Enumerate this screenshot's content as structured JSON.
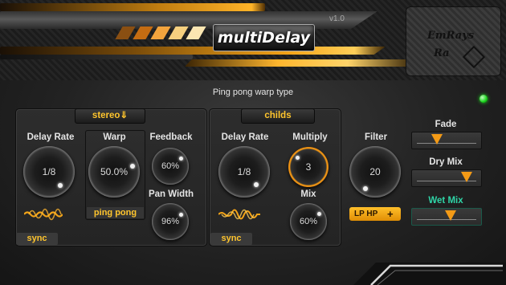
{
  "header": {
    "title": "multiDelay",
    "version": "v1.0",
    "brand_line1": "EmRays",
    "brand_line2": "Ra"
  },
  "subtitle": "Ping pong warp type",
  "colors": {
    "accent": "#ffc52d",
    "knob_ring_active": "#f39a16",
    "led_on": "#18d21a",
    "wet_mix_label": "#2fd6a8"
  },
  "left_panel": {
    "mode": "stereo⇓",
    "delay_rate": {
      "label": "Delay Rate",
      "value": "1/8"
    },
    "warp": {
      "label": "Warp",
      "value": "50.0%",
      "type": "ping pong"
    },
    "feedback": {
      "label": "Feedback",
      "value": "60%"
    },
    "pan_width": {
      "label": "Pan Width",
      "value": "96%"
    },
    "sync_label": "sync"
  },
  "right_panel": {
    "mode": "childs",
    "delay_rate": {
      "label": "Delay Rate",
      "value": "1/8"
    },
    "multiply": {
      "label": "Multiply",
      "value": "3"
    },
    "mix": {
      "label": "Mix",
      "value": "60%"
    },
    "sync_label": "sync"
  },
  "filter": {
    "label": "Filter",
    "value": "20",
    "type_label": "LP HP",
    "plus": "+"
  },
  "sliders": {
    "fade": {
      "label": "Fade",
      "level": 0.3
    },
    "dry_mix": {
      "label": "Dry Mix",
      "level": 0.92
    },
    "wet_mix": {
      "label": "Wet Mix",
      "level": 0.58
    }
  },
  "led": "on"
}
